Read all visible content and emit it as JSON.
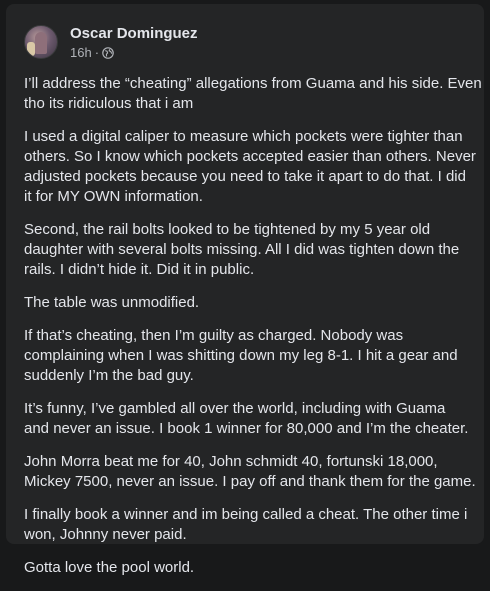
{
  "post": {
    "author": "Oscar Dominguez",
    "time": "16h",
    "separator": "·",
    "privacy_icon": "globe-icon",
    "paragraphs": [
      "I’ll address the “cheating” allegations from Guama and his side. Even\ntho its ridiculous that i am",
      "I used a digital caliper to measure which pockets were tighter than\nothers. So I know which pockets accepted easier than others. Never\nadjusted pockets because you need to take it apart to do that. I did\nit for MY OWN information.",
      "Second, the rail bolts looked to be tightened by my 5 year old\ndaughter with several bolts missing. All I did was tighten down the\nrails. I didn’t hide it. Did it in public.",
      "The table was unmodified.",
      "If that’s cheating, then I’m guilty as charged. Nobody was\ncomplaining when I was shitting down my leg 8-1. I hit a gear and\nsuddenly I’m the bad guy.",
      "It’s funny, I’ve gambled all over the world, including with Guama\nand never an issue. I book 1 winner for 80,000 and I’m the cheater.",
      "John Morra beat me for 40, John schmidt 40, fortunski 18,000,\nMickey 7500, never an issue. I pay off and thank them for the game.",
      "I finally book a winner and im being called a cheat. The other time i\nwon, Johnny never paid.",
      "Gotta love the pool world."
    ]
  },
  "colors": {
    "page_bg": "#18191a",
    "card_bg": "#242526",
    "primary_text": "#e4e6eb",
    "secondary_text": "#b0b3b8"
  }
}
